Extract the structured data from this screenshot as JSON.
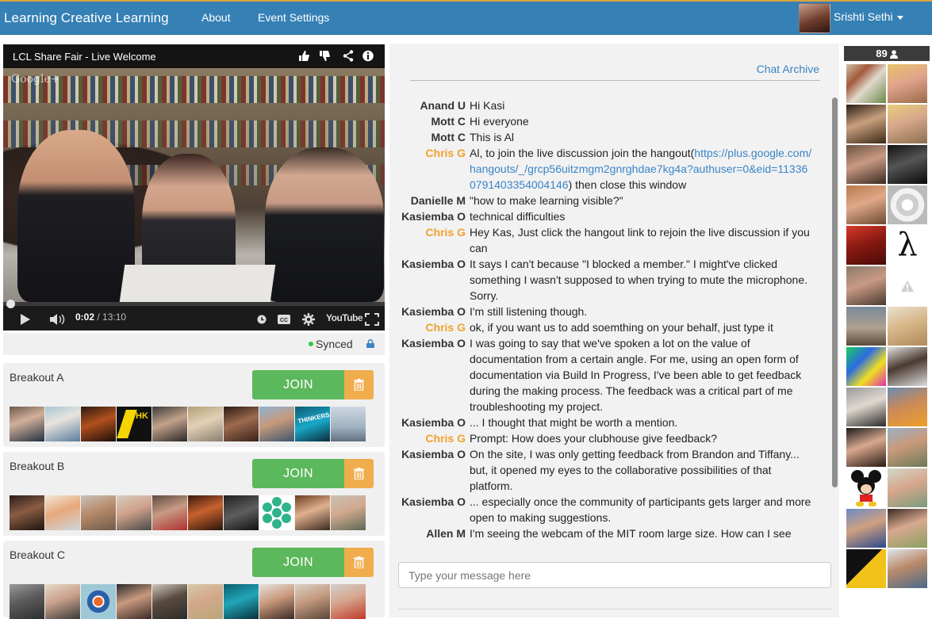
{
  "navbar": {
    "brand": "Learning Creative Learning",
    "links": [
      "About",
      "Event Settings"
    ],
    "user_name": "Srishti Sethi"
  },
  "video": {
    "title": "LCL Share Fair - Live Welcome",
    "watermark": "Google+",
    "current_time": "0:02",
    "total_time": "/ 13:10",
    "progress": 0.003,
    "icons": [
      "thumbs-up-icon",
      "thumbs-down-icon",
      "share-icon",
      "info-icon",
      "play-icon",
      "volume-icon",
      "clock-icon",
      "cc-icon",
      "gear-icon",
      "youtube-logo",
      "fullscreen-icon"
    ],
    "youtube_label": "YouTube"
  },
  "sync": {
    "label": "Synced",
    "status_color": "#2ecc40"
  },
  "breakouts": [
    {
      "name": "Breakout A",
      "join_label": "JOIN"
    },
    {
      "name": "Breakout B",
      "join_label": "JOIN"
    },
    {
      "name": "Breakout C",
      "join_label": "JOIN"
    }
  ],
  "colors": {
    "navbar": "#3580b5",
    "join": "#5cb85c",
    "trash": "#f0ad4e",
    "moderator": "#f0a22e",
    "link": "#3a85c6"
  },
  "chat": {
    "archive_label": "Chat Archive",
    "input_placeholder": "Type your message here",
    "messages": [
      {
        "user": "Anand U",
        "text": "Hi Kasi",
        "mod": false
      },
      {
        "user": "Mott C",
        "text": "Hi everyone",
        "mod": false
      },
      {
        "user": "Mott C",
        "text": "This is Al",
        "mod": false
      },
      {
        "user": "Chris G",
        "text_before": "Al, to join the live discussion join the hangout(",
        "link": "https://plus.google.com/hangouts/_/grcp56uitzmgm2gnrghdae7kg4a?authuser=0&eid=113360791403354004146",
        "text_after": ") then close this window",
        "mod": true
      },
      {
        "user": "Danielle M",
        "text": "\"how to make learning visible?\"",
        "mod": false
      },
      {
        "user": "Kasiemba O",
        "text": "technical difficulties",
        "mod": false
      },
      {
        "user": "Chris G",
        "text": "Hey Kas, Just click the hangout link to rejoin the live discussion if you can",
        "mod": true
      },
      {
        "user": "Kasiemba O",
        "text": "It says I can't because \"I blocked a member.\" I might've clicked something I wasn't supposed to when trying to mute the microphone. Sorry.",
        "mod": false
      },
      {
        "user": "Kasiemba O",
        "text": "I'm still listening though.",
        "mod": false
      },
      {
        "user": "Chris G",
        "text": "ok, if you want us to add soemthing on your behalf, just type it",
        "mod": true
      },
      {
        "user": "Kasiemba O",
        "text": "I was going to say that we've spoken a lot on the value of documentation from a certain angle. For me, using an open form of documentation via Build In Progress, I've been able to get feedback during the making process. The feedback was a critical part of me troubleshooting my project.",
        "mod": false
      },
      {
        "user": "Kasiemba O",
        "text": "... I thought that might be worth a mention.",
        "mod": false
      },
      {
        "user": "Chris G",
        "text": "Prompt: How does your clubhouse give feedback?",
        "mod": true
      },
      {
        "user": "Kasiemba O",
        "text": "On the site, I was only getting feedback from Brandon and Tiffany... but, it opened my eyes to the collaborative possibilities of that platform.",
        "mod": false
      },
      {
        "user": "Kasiemba O",
        "text": "... especially once the community of participants gets larger and more open to making suggestions.",
        "mod": false
      },
      {
        "user": "Allen M",
        "text": "I'm seeing the webcam of the MIT room large size. How can I see",
        "mod": false
      }
    ]
  },
  "participants": {
    "count": "89"
  }
}
